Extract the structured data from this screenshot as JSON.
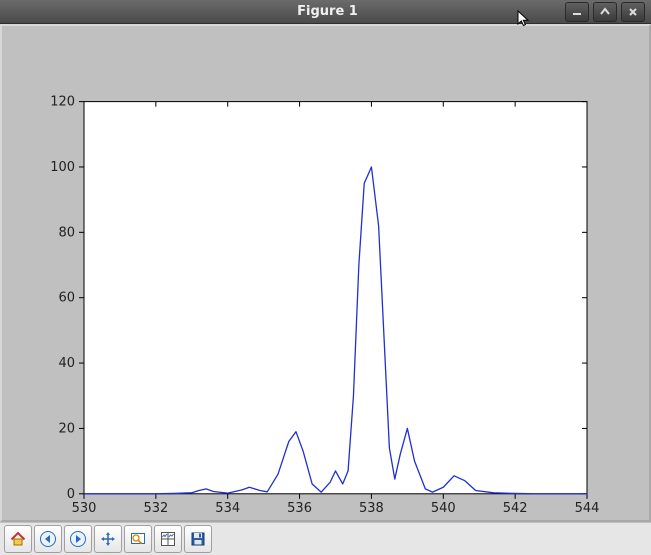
{
  "window": {
    "title": "Figure 1"
  },
  "toolbar": {
    "buttons": [
      {
        "name": "home-button",
        "icon": "home-icon"
      },
      {
        "name": "back-button",
        "icon": "arrow-left-icon"
      },
      {
        "name": "forward-button",
        "icon": "arrow-right-icon"
      },
      {
        "name": "pan-button",
        "icon": "move-icon"
      },
      {
        "name": "zoom-button",
        "icon": "zoom-rect-icon"
      },
      {
        "name": "subplots-button",
        "icon": "subplots-icon"
      },
      {
        "name": "save-button",
        "icon": "save-icon"
      }
    ]
  },
  "chart_data": {
    "type": "line",
    "title": "",
    "xlabel": "",
    "ylabel": "",
    "xlim": [
      530,
      544
    ],
    "ylim": [
      0,
      120
    ],
    "xticks": [
      530,
      532,
      534,
      536,
      538,
      540,
      542,
      544
    ],
    "yticks": [
      0,
      20,
      40,
      60,
      80,
      100,
      120
    ],
    "series": [
      {
        "name": "series-1",
        "color": "#2030d0",
        "x": [
          530.0,
          530.5,
          531.0,
          531.5,
          532.0,
          532.5,
          533.0,
          533.2,
          533.4,
          533.6,
          534.0,
          534.4,
          534.6,
          534.9,
          535.1,
          535.4,
          535.7,
          535.9,
          536.1,
          536.35,
          536.6,
          536.85,
          537.0,
          537.2,
          537.35,
          537.5,
          537.65,
          537.8,
          538.0,
          538.2,
          538.35,
          538.5,
          538.65,
          538.8,
          539.0,
          539.2,
          539.5,
          539.7,
          540.0,
          540.3,
          540.6,
          540.9,
          541.4,
          542.0,
          542.5,
          543.0,
          543.5,
          544.0
        ],
        "y": [
          0.0,
          0.0,
          0.0,
          0.0,
          0.0,
          0.1,
          0.3,
          1.0,
          1.5,
          0.7,
          0.2,
          1.2,
          2.0,
          1.0,
          0.6,
          6.0,
          16.0,
          19.0,
          13.0,
          3.0,
          0.5,
          3.5,
          7.0,
          3.0,
          7.0,
          30.0,
          70.0,
          95.0,
          100.0,
          82.0,
          48.0,
          14.0,
          4.5,
          12.0,
          20.0,
          10.0,
          1.5,
          0.5,
          2.0,
          5.5,
          4.0,
          1.0,
          0.3,
          0.1,
          0.0,
          0.0,
          0.0,
          0.0
        ]
      }
    ]
  }
}
